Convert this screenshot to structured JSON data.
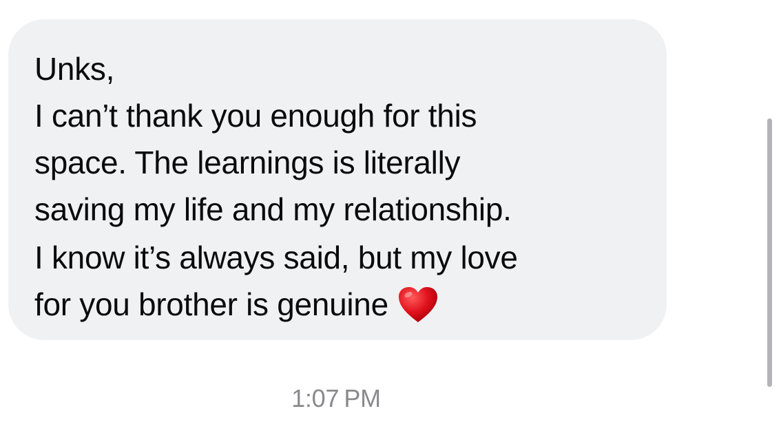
{
  "message": {
    "lines": [
      "Unks,",
      "I can’t thank you enough for this",
      "space. The learnings is literally",
      "saving my life and my relationship.",
      "I know it’s always said, but my love",
      "for you brother is genuine"
    ],
    "emoji": "heart-icon",
    "bubble_color": "#f0f1f3",
    "text_color": "#0b0b0c"
  },
  "timestamp": "1:07 PM"
}
